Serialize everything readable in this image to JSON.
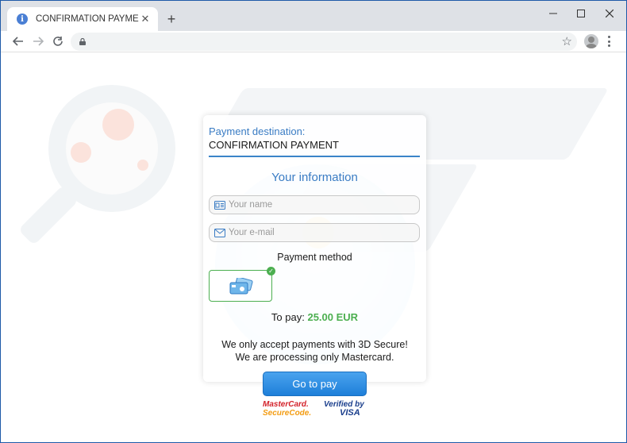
{
  "browser": {
    "tab_title": "CONFIRMATION PAYMENT",
    "tab_close": "✕",
    "new_tab": "+",
    "favicon": "i",
    "address": ""
  },
  "page": {
    "destination_label": "Payment destination:",
    "destination_value": "CONFIRMATION PAYMENT",
    "section_title": "Your information",
    "name_placeholder": "Your name",
    "email_placeholder": "Your e-mail",
    "payment_method_title": "Payment method",
    "to_pay_label": "To pay:",
    "to_pay_amount": "25.00 EUR",
    "notice_line1": "We only accept payments with 3D Secure!",
    "notice_line2": "We are processing only Mastercard.",
    "pay_button": "Go to pay",
    "logo_mastercard_1": "MasterCard.",
    "logo_mastercard_2": "SecureCode.",
    "logo_visa_1": "Verified by",
    "logo_visa_2": "VISA"
  },
  "colors": {
    "accent": "#3a7cc4",
    "amount": "#4caf50",
    "button": "#1e7fd9"
  }
}
